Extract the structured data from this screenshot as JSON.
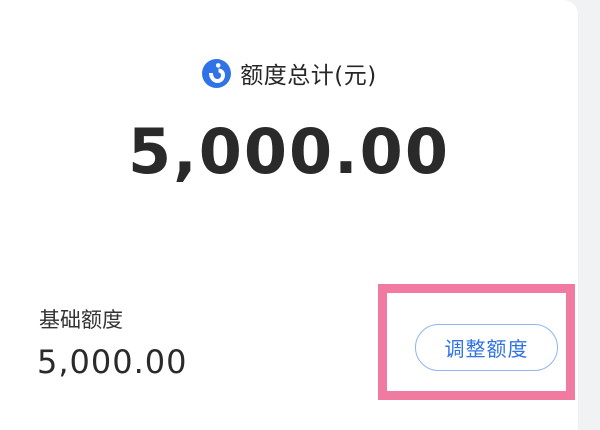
{
  "colors": {
    "accent": "#2f73e6",
    "highlight": "#f07aa0",
    "text": "#2a2a2a"
  },
  "header": {
    "icon": "brand-logo-icon",
    "title": "额度总计(元)"
  },
  "total": {
    "amount": "5,000.00"
  },
  "base": {
    "label": "基础额度",
    "amount": "5,000.00"
  },
  "actions": {
    "adjust_label": "调整额度"
  }
}
